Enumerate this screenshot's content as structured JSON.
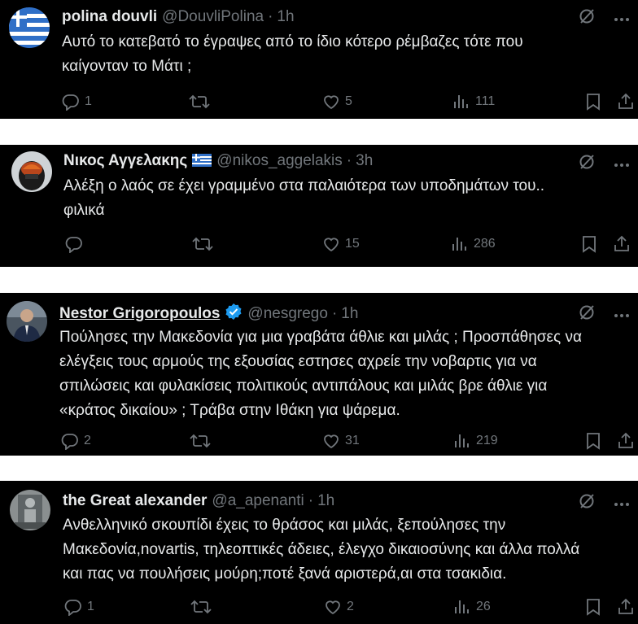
{
  "tweets": [
    {
      "name": "polina douvli",
      "handle": "@DouvliPolina",
      "time": "1h",
      "line1": "Αυτό το κατεβατό το έγραψες από το ίδιο κότερο ρέμβαζες τότε που",
      "line2": "καίγονταν το Μάτι ;",
      "line3": "",
      "line4": "",
      "replies": "1",
      "retweets": "",
      "likes": "5",
      "views": "111"
    },
    {
      "name": "Νικος Αγγελακης",
      "handle": "@nikos_aggelakis",
      "time": "3h",
      "line1": "Αλέξη ο λαός σε έχει γραμμένο στα παλαιότερα των υποδημάτων του..",
      "line2": "φιλικά",
      "line3": "",
      "line4": "",
      "replies": "",
      "retweets": "",
      "likes": "15",
      "views": "286"
    },
    {
      "name": "Nestor Grigoropoulos",
      "handle": "@nesgrego",
      "time": "1h",
      "line1": "Πούλησες την Μακεδονία για μια γραβάτα άθλιε και μιλάς ; Προσπάθησες να",
      "line2": "ελέγξεις τους αρμούς της εξουσίας εστησες αχρείε την νοβαρτις για να",
      "line3": "σπιλώσεις και φυλακίσεις πολιτικούς αντιπάλους και μιλάς βρε άθλιε για",
      "line4": "«κράτος δικαίου» ; Τράβα στην Ιθάκη για ψάρεμα.",
      "replies": "2",
      "retweets": "",
      "likes": "31",
      "views": "219"
    },
    {
      "name": "the Great alexander",
      "handle": "@a_apenanti",
      "time": "1h",
      "line1": "Ανθελληνικό σκουπίδι έχεις το θράσος και μιλάς, ξεπούλησες την",
      "line2": "Μακεδονία,novartis, τηλεοπτικές άδειες, έλεγχο δικαιοσύνης και άλλα πολλά",
      "line3": "και πας να πουλήσεις μούρη;ποτέ ξανά αριστερά,αι στα τσακιδια.",
      "line4": "",
      "replies": "1",
      "retweets": "",
      "likes": "2",
      "views": "26"
    }
  ],
  "icons": {
    "reply": "reply-icon",
    "retweet": "retweet-icon",
    "like": "heart-icon",
    "views": "views-icon",
    "bookmark": "bookmark-icon",
    "share": "share-icon",
    "grok": "grok-icon",
    "more": "more-icon"
  },
  "colors": {
    "background": "#000000",
    "text": "#e7e9ea",
    "muted": "#71767b",
    "verified": "#1d9bf0"
  }
}
